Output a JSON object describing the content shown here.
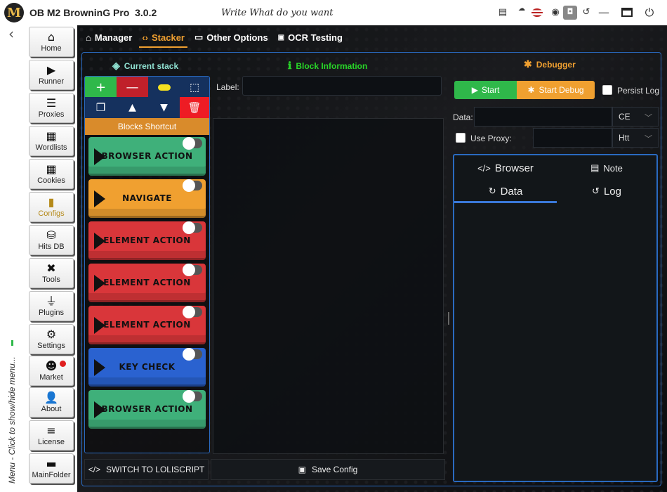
{
  "titlebar": {
    "logo_letter": "M",
    "app_title": "OB M2 BrowninG Pro",
    "version": "3.0.2",
    "tagline": "Write What do you want",
    "icons": [
      "document-icon",
      "cloud-icon",
      "us-flag-icon",
      "telegram-icon",
      "camera-icon",
      "history-icon",
      "minimize-icon",
      "maximize-icon",
      "power-icon"
    ]
  },
  "sidebar": {
    "back_glyph": "‹",
    "menu_hint": "Menu - Click to show/hide menu...",
    "nav": [
      {
        "label": "Home",
        "icon": "home-icon"
      },
      {
        "label": "Runner",
        "icon": "play-icon"
      },
      {
        "label": "Proxies",
        "icon": "server-icon"
      },
      {
        "label": "Wordlists",
        "icon": "wordlist-icon"
      },
      {
        "label": "Cookies",
        "icon": "cookies-icon"
      },
      {
        "label": "Configs",
        "icon": "book-icon"
      },
      {
        "label": "Hits DB",
        "icon": "database-icon"
      },
      {
        "label": "Tools",
        "icon": "tools-icon"
      },
      {
        "label": "Plugins",
        "icon": "plug-icon"
      },
      {
        "label": "Settings",
        "icon": "gear-icon"
      },
      {
        "label": "Market",
        "icon": "alien-icon"
      },
      {
        "label": "About",
        "icon": "user-question-icon"
      },
      {
        "label": "License",
        "icon": "license-icon"
      },
      {
        "label": "MainFolder",
        "icon": "folder-icon"
      }
    ],
    "active": "Configs"
  },
  "tabs": [
    {
      "label": "Manager",
      "icon": "home-circle-icon"
    },
    {
      "label": "Stacker",
      "icon": "code-icon",
      "active": true
    },
    {
      "label": "Other Options",
      "icon": "chat-icon"
    },
    {
      "label": "OCR Testing",
      "icon": "ocr-icon"
    }
  ],
  "stacker": {
    "current_stack_title": "Current stack",
    "block_info_title": "Block Information",
    "debugger_title": "Debugger",
    "blocks_shortcut": "Blocks Shortcut",
    "blocks": [
      {
        "label": "BROWSER ACTION",
        "color": "#3fb07a"
      },
      {
        "label": "NAVIGATE",
        "color": "#f0a030"
      },
      {
        "label": "ELEMENT ACTION",
        "color": "#d9363a"
      },
      {
        "label": "ELEMENT ACTION",
        "color": "#d9363a"
      },
      {
        "label": "ELEMENT ACTION",
        "color": "#d9363a"
      },
      {
        "label": "KEY CHECK",
        "color": "#2a62d0"
      },
      {
        "label": "BROWSER ACTION",
        "color": "#3fb07a"
      }
    ],
    "label_field": {
      "label": "Label:",
      "value": ""
    },
    "switch_button": "SWITCH TO LOLISCRIPT",
    "save_button": "Save Config"
  },
  "debugger": {
    "start": "Start",
    "start_debug": "Start Debug",
    "persist_log": "Persist Log",
    "data_label": "Data:",
    "data_type": "CE",
    "use_proxy": "Use Proxy:",
    "proxy_type": "Htt",
    "tabs": [
      {
        "label": "Browser",
        "icon": "code-icon"
      },
      {
        "label": "Note",
        "icon": "note-icon"
      },
      {
        "label": "Data",
        "icon": "refresh-icon",
        "active": true
      },
      {
        "label": "Log",
        "icon": "history-icon"
      }
    ]
  },
  "colors": {
    "accent": "#f0a030",
    "frame": "#2a6ac0",
    "green": "#2fb84a",
    "red": "#c0202a"
  }
}
